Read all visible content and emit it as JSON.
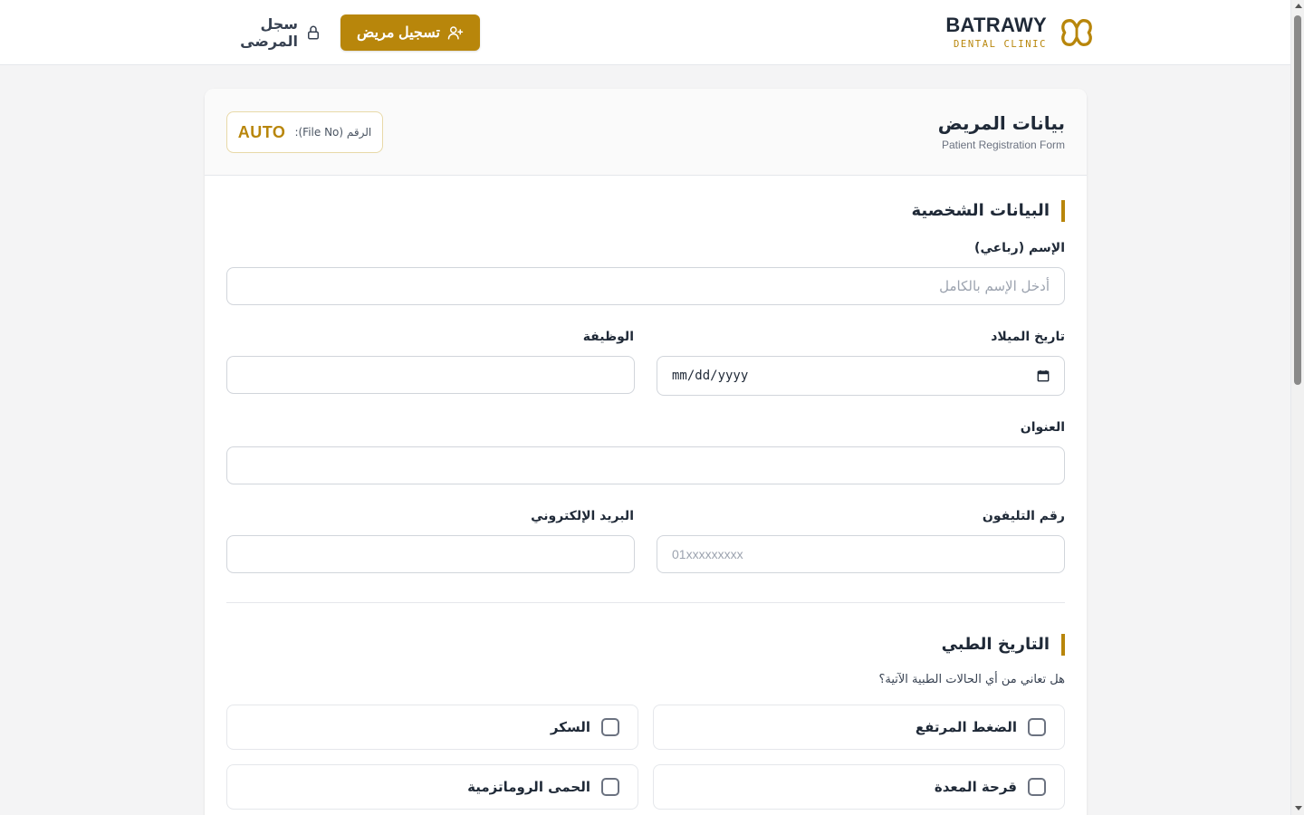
{
  "header": {
    "brand_name": "BATRAWY",
    "brand_sub": "DENTAL CLINIC",
    "register_button": "تسجيل مريض",
    "records_button": "سجل المرضى"
  },
  "form": {
    "title": "بيانات المريض",
    "subtitle": "Patient Registration Form",
    "file_label": "الرقم (File No):",
    "file_value": "AUTO"
  },
  "personal": {
    "section_title": "البيانات الشخصية",
    "name_label": "الإسم (رباعي)",
    "name_placeholder": "أدخل الإسم بالكامل",
    "dob_label": "تاريخ الميلاد",
    "dob_value": "mm/dd/yyyy",
    "job_label": "الوظيفة",
    "address_label": "العنوان",
    "phone_label": "رقم التليفون",
    "phone_placeholder": "01xxxxxxxxx",
    "email_label": "البريد الإلكتروني"
  },
  "medical": {
    "section_title": "التاريخ الطبي",
    "question": "هل تعاني من أي الحالات الطبية الآتية؟",
    "conditions": [
      {
        "label": "الضغط المرتفع",
        "checked": false
      },
      {
        "label": "السكر",
        "checked": false
      },
      {
        "label": "قرحة المعدة",
        "checked": false
      },
      {
        "label": "الحمى الروماتزمية",
        "checked": false
      }
    ]
  },
  "colors": {
    "accent": "#b8860b",
    "background": "#f4f4f5",
    "card": "#ffffff"
  }
}
